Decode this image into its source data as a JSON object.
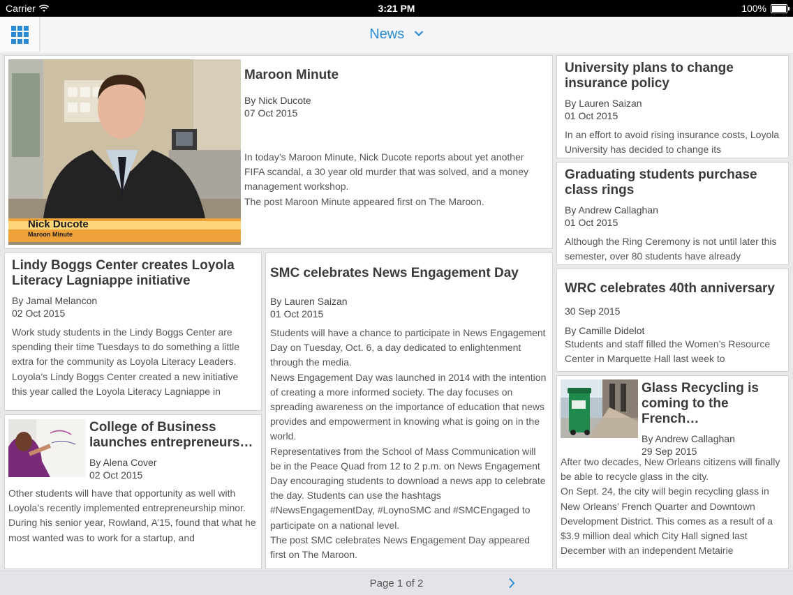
{
  "status_bar": {
    "carrier": "Carrier",
    "time": "3:21 PM",
    "battery": "100%"
  },
  "nav": {
    "title": "News",
    "grid_icon": "grid-icon",
    "dropdown_icon": "chevron-down-icon"
  },
  "articles": {
    "maroon": {
      "title": "Maroon Minute",
      "author": "By Nick Ducote",
      "date": "07 Oct 2015",
      "body": "In today’s Maroon Minute,  Nick Ducote reports about yet another FIFA scandal, a 30 year old murder that was solved, and a money management workshop.\nThe post Maroon Minute appeared first on The Maroon.",
      "image": {
        "caption_name": "Nick Ducote",
        "caption_show": "Maroon Minute"
      }
    },
    "insurance": {
      "title": "University plans to change insurance policy",
      "author": "By Lauren Saizan",
      "date": "01 Oct 2015",
      "body": "In an effort to avoid rising insurance costs, Loyola University has decided to change its"
    },
    "rings": {
      "title": "Graduating students purchase class rings",
      "author": "By Andrew Callaghan",
      "date": "01 Oct 2015",
      "body": "Although the Ring Ceremony is not until later this semester, over 80 students have already"
    },
    "lindy": {
      "title": "Lindy Boggs Center creates Loyola Literacy Lagniappe initiative",
      "author": "By Jamal Melancon",
      "date": "02 Oct 2015",
      "body": "Work study students in the Lindy Boggs Center are spending their time Tuesdays to do something a little extra for the community as Loyola Literacy Leaders.\nLoyola’s Lindy Boggs Center created a new initiative this year called the Loyola Literacy Lagniappe in"
    },
    "smc": {
      "title": "SMC celebrates News Engagement Day",
      "author": "By Lauren Saizan",
      "date": "01 Oct 2015",
      "body": "Students will have a chance to participate in News Engagement Day on Tuesday, Oct. 6, a day dedicated to enlightenment through the media.\nNews Engagement Day was launched in 2014 with the intention of creating a more informed society. The day focuses on spreading awareness on the importance of education that news provides and empowerment in knowing what is going on in the world.\nRepresentatives from the School of Mass Communication will be in the Peace Quad from 12 to 2 p.m. on News Engagement Day encouraging students to download a news app to celebrate the day. Students can use the hashtags #NewsEngagementDay, #LoynoSMC and #SMCEngaged to participate on a national level.\nThe post SMC celebrates News Engagement Day appeared first on The Maroon."
    },
    "wrc": {
      "title": "WRC celebrates 40th anniversary",
      "date": "30 Sep 2015",
      "author": "By Camille Didelot",
      "body": "Students and staff filled the Women’s Resource Center in Marquette Hall last week to"
    },
    "business": {
      "title": "College of Business launches entrepreneurs…",
      "author": "By Alena Cover",
      "date": "02 Oct 2015",
      "body": "Other students will have that opportunity as well with Loyola’s recently implemented entrepreneurship minor.\nDuring his senior year, Rowland, A’15, found that what he most wanted was to work for a startup, and"
    },
    "glass": {
      "title": "Glass Recycling is coming to the French…",
      "author": "By Andrew Callaghan",
      "date": "29 Sep 2015",
      "body": "After two decades, New Orleans citizens will finally be able to recycle glass in the city.\nOn Sept. 24, the city will begin recycling glass in New Orleans’ French Quarter and Downtown Development District. This comes as a result of a $3.9 million deal which City Hall signed last December with an independent Metairie"
    }
  },
  "pager": {
    "label": "Page 1 of 2",
    "next_icon": "chevron-right-icon"
  },
  "colors": {
    "accent": "#2a8ad4",
    "background": "#e9e9ec",
    "card": "#ffffff"
  }
}
